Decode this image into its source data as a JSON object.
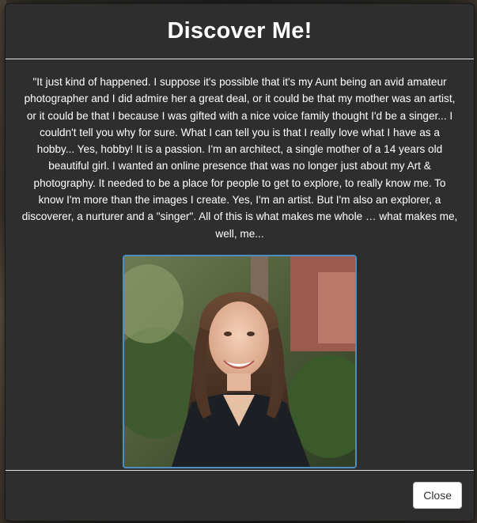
{
  "modal": {
    "title": "Discover Me!",
    "quote": "\"It just kind of happened. I suppose it's possible that it's my Aunt being an avid amateur photographer and I did admire her a great deal, or it could be that my mother was an artist, or it could be that I because I was gifted with a nice voice family thought I'd be a singer... I couldn't tell you why for sure. What I can tell you is that I really love what I have as a hobby... Yes, hobby! It is a passion. I'm an architect, a single mother of a 14 years old beautiful girl. I wanted an online presence that was no longer just about my Art & photography. It needed to be a place for people to get to explore, to really know me. To know I'm more than the images I create. Yes, I'm an artist. But I'm also an explorer, a discoverer, a nurturer and a \"singer\". All of this is what makes me whole … what makes me, well, me...",
    "close_label": "Close"
  },
  "colors": {
    "modal_background": "#2e2e2e",
    "title_text": "#ffffff",
    "photo_border": "#4b8fc4",
    "divider": "#e5e5e5"
  }
}
